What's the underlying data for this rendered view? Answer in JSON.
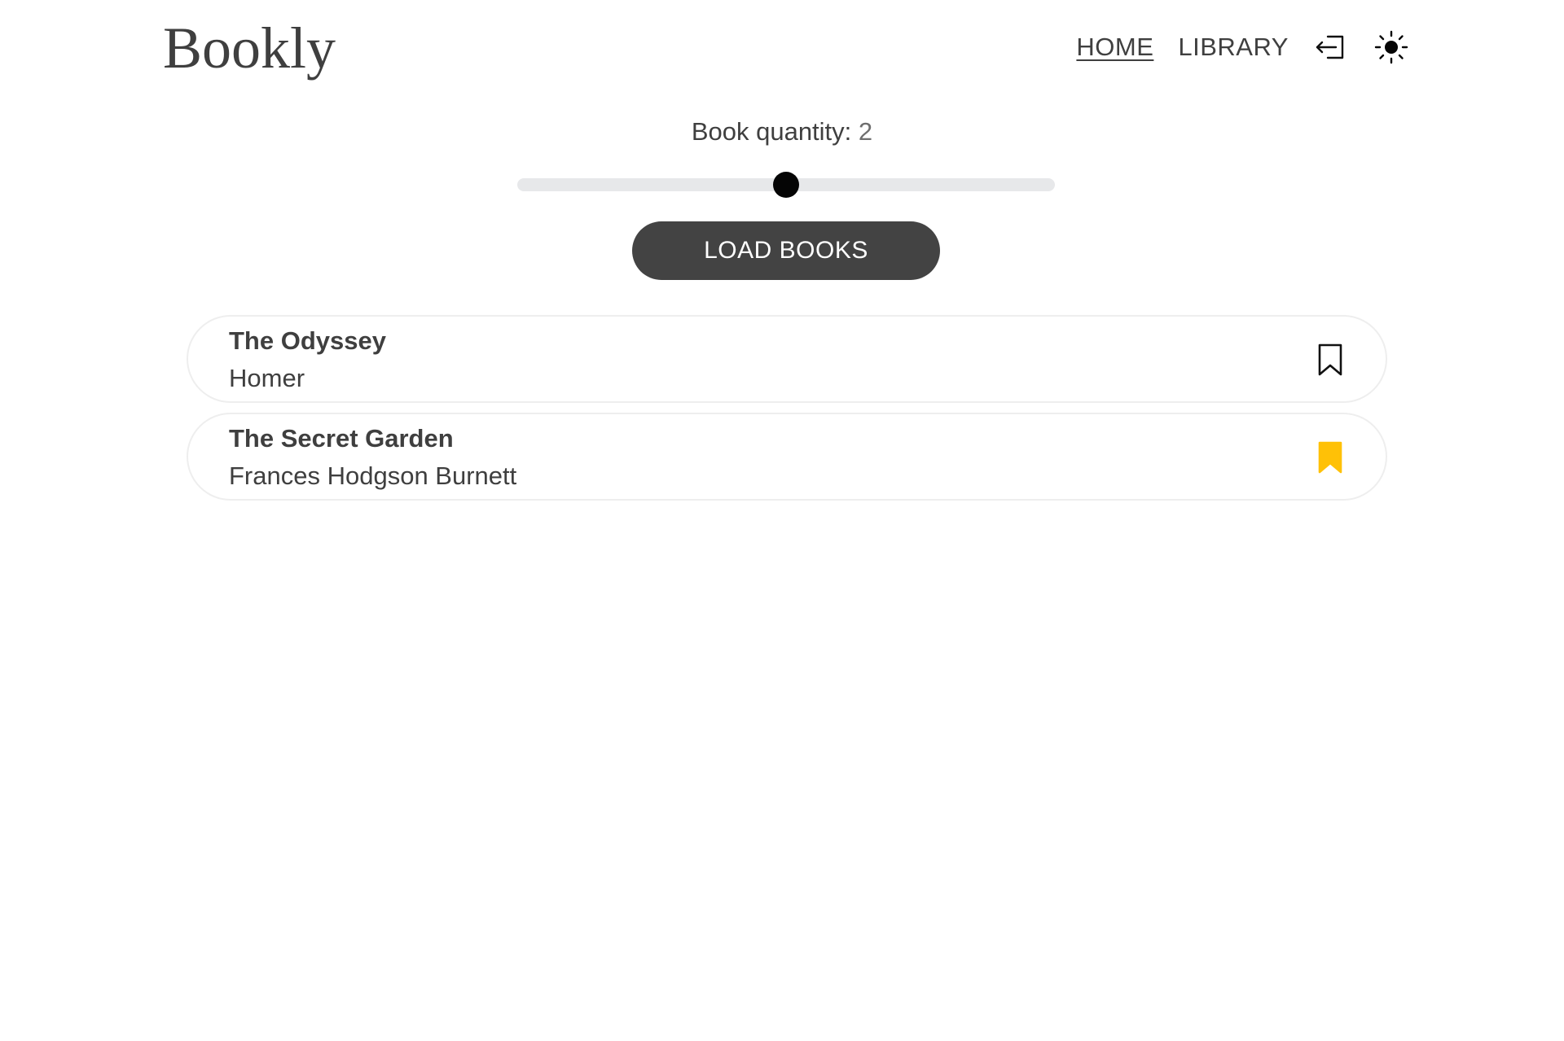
{
  "header": {
    "logo": "Bookly",
    "nav": [
      {
        "label": "HOME",
        "active": true
      },
      {
        "label": "LIBRARY",
        "active": false
      }
    ],
    "icons": {
      "login": "login-icon",
      "theme": "sun-icon"
    }
  },
  "quantity": {
    "label": "Book quantity:",
    "value": "2",
    "slider_fraction": 0.5
  },
  "load_button": {
    "label": "LOAD BOOKS"
  },
  "books": [
    {
      "title": "The Odyssey",
      "author": "Homer",
      "bookmarked": false
    },
    {
      "title": "The Secret Garden",
      "author": "Frances Hodgson Burnett",
      "bookmarked": true
    }
  ],
  "colors": {
    "bookmark_active": "#FFC107",
    "bookmark_inactive": "#111111",
    "button_bg": "#434343",
    "slider_track": "#e7e8ea",
    "slider_thumb": "#050505"
  }
}
